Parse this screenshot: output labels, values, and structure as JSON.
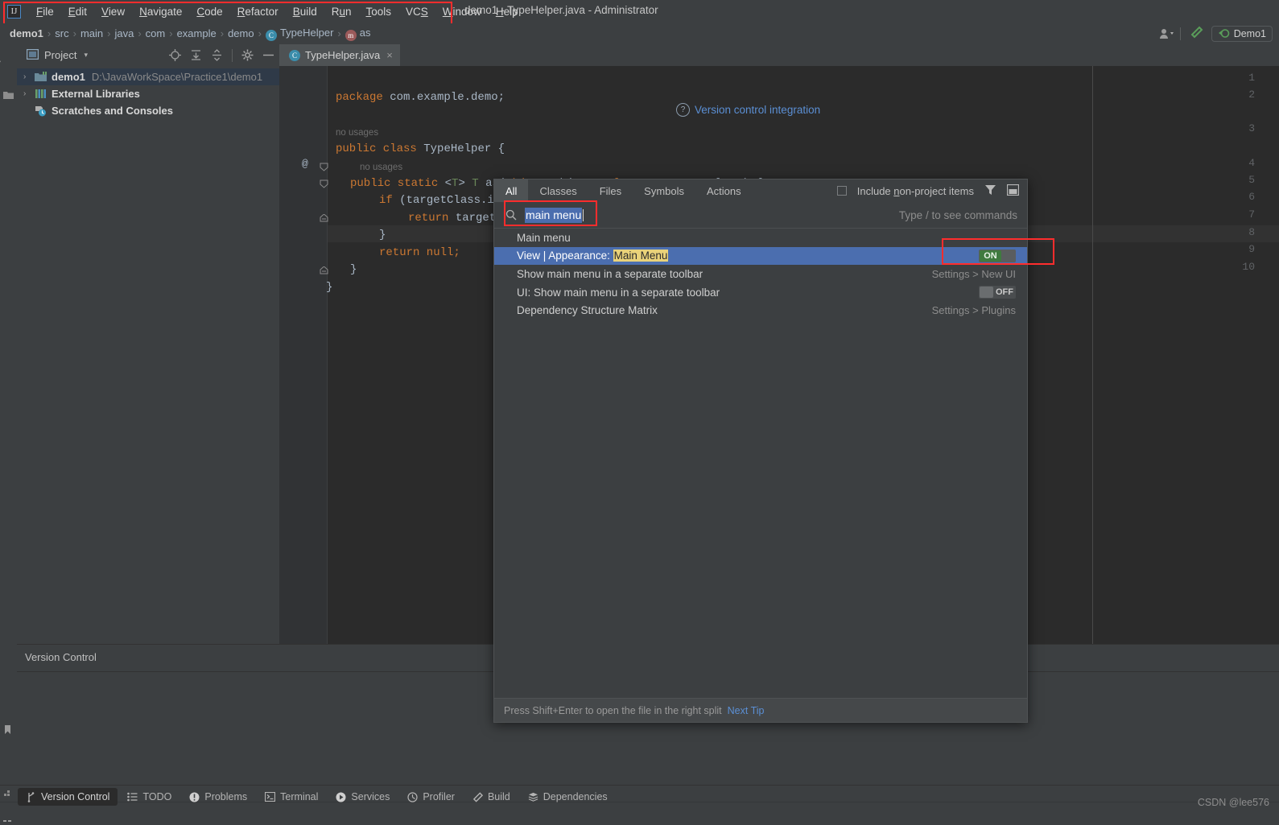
{
  "window": {
    "title": "demo1 - TypeHelper.java - Administrator",
    "logo": "IJ"
  },
  "menubar": {
    "items": [
      {
        "label": "File",
        "mnemonic": "F"
      },
      {
        "label": "Edit",
        "mnemonic": "E"
      },
      {
        "label": "View",
        "mnemonic": "V"
      },
      {
        "label": "Navigate",
        "mnemonic": "N"
      },
      {
        "label": "Code",
        "mnemonic": "C"
      },
      {
        "label": "Refactor",
        "mnemonic": "R"
      },
      {
        "label": "Build",
        "mnemonic": "B"
      },
      {
        "label": "Run",
        "mnemonic": "u"
      },
      {
        "label": "Tools",
        "mnemonic": "T"
      },
      {
        "label": "VCS",
        "mnemonic": "S"
      },
      {
        "label": "Window",
        "mnemonic": "W"
      },
      {
        "label": "Help",
        "mnemonic": "H"
      }
    ]
  },
  "breadcrumb": {
    "items": [
      {
        "label": "demo1",
        "icon": null,
        "bold": true
      },
      {
        "label": "src",
        "icon": null,
        "bold": false
      },
      {
        "label": "main",
        "icon": null,
        "bold": false
      },
      {
        "label": "java",
        "icon": null,
        "bold": false
      },
      {
        "label": "com",
        "icon": null,
        "bold": false
      },
      {
        "label": "example",
        "icon": null,
        "bold": false
      },
      {
        "label": "demo",
        "icon": null,
        "bold": false
      },
      {
        "label": "TypeHelper",
        "icon": "class-icon",
        "bold": false
      },
      {
        "label": "as",
        "icon": "method-icon",
        "bold": false
      }
    ],
    "separator": "›",
    "class_icon_glyph": "C",
    "method_icon_glyph": "m"
  },
  "toolbar_right": {
    "account_icon": "account-icon",
    "build_icon": "hammer-icon",
    "run_config": "Demo1",
    "run_config_icon": "run-config-icon"
  },
  "left_strip": {
    "items": [
      {
        "label": "Project",
        "icon": "project-icon"
      },
      {
        "label": "Bookmarks",
        "icon": "bookmark-icon"
      },
      {
        "label": "Structure",
        "icon": "structure-icon"
      }
    ],
    "folder_icon": "folder-icon"
  },
  "project_panel": {
    "title": "Project",
    "title_icon": "project-window-icon",
    "caret": "▾",
    "tools": [
      "locate-icon",
      "expand-all-icon",
      "collapse-all-icon",
      "gear-icon",
      "minimize-icon"
    ],
    "tree": [
      {
        "arrow": "›",
        "icon": "module-icon",
        "name": "demo1",
        "path": "D:\\JavaWorkSpace\\Practice1\\demo1",
        "selected": true
      },
      {
        "arrow": "›",
        "icon": "library-icon",
        "name": "External Libraries",
        "path": "",
        "selected": false
      },
      {
        "arrow": "",
        "icon": "scratches-icon",
        "name": "Scratches and Consoles",
        "path": "",
        "selected": false
      }
    ]
  },
  "editor": {
    "tab": {
      "label": "TypeHelper.java",
      "icon_glyph": "C",
      "close_glyph": "×"
    },
    "lines": [
      {
        "num": "1",
        "text": "package com.example.demo;",
        "highlighted": false
      },
      {
        "num": "2",
        "text": "",
        "highlighted": false
      },
      {
        "num": "3",
        "text": "public class TypeHelper {",
        "highlighted": false
      },
      {
        "num": "4",
        "text": "    public static <T> T as(Object object, Class<T> targetClass) {",
        "highlighted": false
      },
      {
        "num": "5",
        "text": "        if (targetClass.is",
        "highlighted": false
      },
      {
        "num": "6",
        "text": "            return target(",
        "highlighted": false
      },
      {
        "num": "7",
        "text": "        }",
        "highlighted": false
      },
      {
        "num": "8",
        "text": "        return null;",
        "highlighted": true
      },
      {
        "num": "9",
        "text": "    }",
        "highlighted": false
      },
      {
        "num": "10",
        "text": "}",
        "highlighted": false
      }
    ],
    "inlay_hints": [
      "no usages",
      "no usages"
    ],
    "annotation_marker": "@"
  },
  "search_everywhere": {
    "tabs": [
      {
        "label": "All",
        "selected": true
      },
      {
        "label": "Classes",
        "selected": false
      },
      {
        "label": "Files",
        "selected": false
      },
      {
        "label": "Symbols",
        "selected": false
      },
      {
        "label": "Actions",
        "selected": false
      }
    ],
    "include_non_project": {
      "label_pre": "Include ",
      "label_mn": "n",
      "label_post": "on-project items",
      "checked": false
    },
    "filter_icon": "filter-icon",
    "preview_icon": "preview-panel-icon",
    "search_icon": "search-icon",
    "query": "main menu",
    "hint": "Type / to see commands",
    "results": [
      {
        "text": "Main menu",
        "meta": "",
        "toggle": null,
        "selected": false,
        "match": null
      },
      {
        "text_pre": "View | Appearance: ",
        "match": "Main Menu",
        "text_post": "",
        "meta": "",
        "toggle": "ON",
        "selected": true
      },
      {
        "text": "Show main menu in a separate toolbar",
        "meta": "Settings > New UI",
        "toggle": null,
        "selected": false
      },
      {
        "text": "UI: Show main menu in a separate toolbar",
        "meta": "",
        "toggle": "OFF",
        "selected": false
      },
      {
        "text": "Dependency Structure Matrix",
        "meta": "Settings > Plugins",
        "toggle": null,
        "selected": false
      }
    ],
    "footer": {
      "text": "Press Shift+Enter to open the file in the right split",
      "link": "Next Tip"
    }
  },
  "version_control_panel": {
    "title": "Version Control",
    "link": "Version control integration",
    "link_icon": "help-circle-icon"
  },
  "status_bar": {
    "items": [
      {
        "label": "Version Control",
        "icon": "branch-icon",
        "active": true
      },
      {
        "label": "TODO",
        "icon": "todo-icon",
        "active": false
      },
      {
        "label": "Problems",
        "icon": "problems-icon",
        "active": false
      },
      {
        "label": "Terminal",
        "icon": "terminal-icon",
        "active": false
      },
      {
        "label": "Services",
        "icon": "services-icon",
        "active": false
      },
      {
        "label": "Profiler",
        "icon": "profiler-icon",
        "active": false
      },
      {
        "label": "Build",
        "icon": "build-icon",
        "active": false
      },
      {
        "label": "Dependencies",
        "icon": "dependencies-icon",
        "active": false
      }
    ],
    "watermark": "CSDN @lee576"
  },
  "annotations": {
    "highlight_color": "#ff2d2d",
    "selection_color": "#4b6eaf",
    "match_color": "#e9d27a",
    "toggle_on_color": "#3f7a3f"
  }
}
